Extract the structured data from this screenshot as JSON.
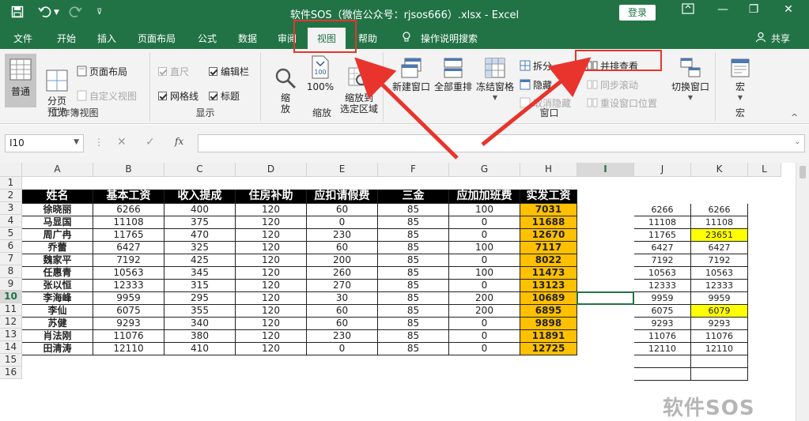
{
  "window": {
    "title": "软件SOS（微信公众号：rjsos666）.xlsx  -  Excel",
    "login_label": "登录",
    "minimize_glyph": "—",
    "restore_glyph": "❐",
    "close_glyph": "✕"
  },
  "quick_access": {
    "save_icon": "save-icon",
    "undo_icon": "undo-icon",
    "redo_icon": "redo-icon",
    "customize_icon": "customize-icon"
  },
  "tabs": [
    "文件",
    "开始",
    "插入",
    "页面布局",
    "公式",
    "数据",
    "审阅",
    "视图",
    "帮助"
  ],
  "active_tab": "视图",
  "tell_me": "操作说明搜索",
  "share": "共享",
  "ribbon": {
    "workbook_views": {
      "label": "工作簿视图",
      "normal": "普通",
      "page_break_preview": "分页\n预览",
      "page_layout": "页面布局",
      "custom_views": "自定义视图"
    },
    "show": {
      "label": "显示",
      "ruler": "直尺",
      "formula_bar": "编辑栏",
      "gridlines": "网格线",
      "headings": "标题"
    },
    "zoom": {
      "label": "缩放",
      "zoom": "缩\n放",
      "zoom_100": "100%",
      "zoom_selection": "缩放到\n选定区域"
    },
    "window": {
      "label": "窗口",
      "new_window": "新建窗口",
      "arrange_all": "全部重排",
      "freeze_panes": "冻结窗格",
      "split": "拆分",
      "hide": "隐藏",
      "unhide": "取消隐藏",
      "view_side_by_side": "并排查看",
      "sync_scroll": "同步滚动",
      "reset_position": "重设窗口位置",
      "switch_windows": "切换窗口"
    },
    "macros": {
      "label": "宏",
      "macros": "宏"
    }
  },
  "formula_bar": {
    "name_box": "I10",
    "fx_label": "fx",
    "formula": ""
  },
  "columns": [
    "A",
    "B",
    "C",
    "D",
    "E",
    "F",
    "G",
    "H",
    "I",
    "J",
    "K",
    "L"
  ],
  "rows": [
    "1",
    "2",
    "3",
    "4",
    "5",
    "6",
    "7",
    "8",
    "9",
    "10",
    "11",
    "12",
    "13",
    "14",
    "15",
    "16"
  ],
  "selected_row": "10",
  "selected_col": "I",
  "table": {
    "headers": [
      "姓名",
      "基本工资",
      "收入提成",
      "住房补助",
      "应扣请假费",
      "三金",
      "应加加班费",
      "实发工资"
    ],
    "rows": [
      [
        "徐晓丽",
        "6266",
        "400",
        "120",
        "60",
        "85",
        "100",
        "7031"
      ],
      [
        "马显国",
        "11108",
        "375",
        "120",
        "0",
        "85",
        "0",
        "11688"
      ],
      [
        "周广冉",
        "11765",
        "470",
        "120",
        "230",
        "85",
        "0",
        "12670"
      ],
      [
        "乔蕾",
        "6427",
        "325",
        "120",
        "60",
        "85",
        "100",
        "7117"
      ],
      [
        "魏家平",
        "7192",
        "425",
        "120",
        "200",
        "85",
        "0",
        "8022"
      ],
      [
        "任惠青",
        "10563",
        "345",
        "120",
        "260",
        "85",
        "100",
        "11473"
      ],
      [
        "张以恒",
        "12333",
        "315",
        "120",
        "270",
        "85",
        "0",
        "13123"
      ],
      [
        "李海峰",
        "9959",
        "295",
        "120",
        "30",
        "85",
        "200",
        "10689"
      ],
      [
        "李仙",
        "6075",
        "355",
        "120",
        "60",
        "85",
        "200",
        "6895"
      ],
      [
        "苏健",
        "9293",
        "340",
        "120",
        "60",
        "85",
        "0",
        "9898"
      ],
      [
        "肖法刚",
        "11076",
        "380",
        "120",
        "230",
        "85",
        "0",
        "11891"
      ],
      [
        "田清涛",
        "12110",
        "410",
        "120",
        "0",
        "85",
        "0",
        "12725"
      ]
    ]
  },
  "side_table": {
    "j": [
      "6266",
      "11108",
      "11765",
      "6427",
      "7192",
      "10563",
      "12333",
      "9959",
      "6075",
      "9293",
      "11076",
      "12110"
    ],
    "k": [
      "6266",
      "11108",
      "23651",
      "6427",
      "7192",
      "10563",
      "12333",
      "9959",
      "6079",
      "9293",
      "11076",
      "12110"
    ],
    "highlight_rows": [
      2,
      8
    ]
  },
  "watermark": "软件SOS",
  "colors": {
    "excel_green": "#217346",
    "header_black": "#000000",
    "salary_orange": "#ffc000",
    "highlight_yellow": "#ffff00",
    "annotation_red": "#e8342c"
  }
}
